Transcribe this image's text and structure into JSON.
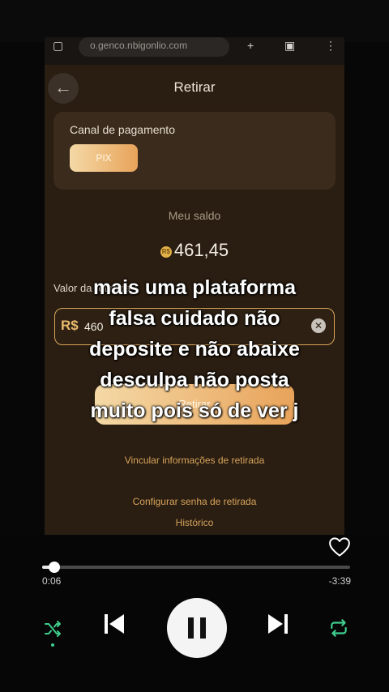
{
  "browser": {
    "url": "o.genco.nbigonlio.com"
  },
  "app": {
    "title": "Retirar",
    "payment_channel": {
      "label": "Canal de pagamento",
      "option": "PIX"
    },
    "balance": {
      "label": "Meu saldo",
      "currency_symbol": "R$",
      "amount": "461,45"
    },
    "withdraw": {
      "label": "Valor da retirada",
      "currency": "R$",
      "value": "460",
      "button": "Retirar"
    },
    "links": {
      "bind_info": "Vincular informações de retirada",
      "set_password": "Configurar senha de retirada",
      "history": "Histórico"
    }
  },
  "overlay_caption": {
    "lines": [
      "mais uma plataforma",
      "falsa cuidado não",
      "deposite e não abaixe",
      "desculpa não posta",
      "muito pois só de ver j"
    ]
  },
  "player": {
    "elapsed": "0:06",
    "remaining": "-3:39",
    "progress": 0.04,
    "accent_color": "#3fcf8e"
  }
}
